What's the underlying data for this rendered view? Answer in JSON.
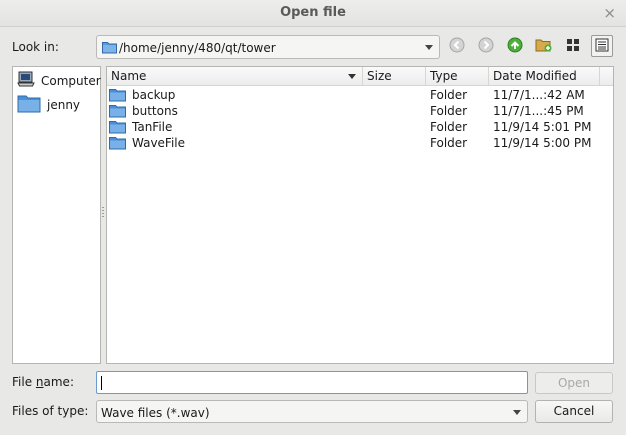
{
  "window": {
    "title": "Open file",
    "close_glyph": "×"
  },
  "look_in": {
    "label": "Look in:",
    "path": "/home/jenny/480/qt/tower"
  },
  "toolbar": {
    "buttons": [
      "back-icon",
      "forward-icon",
      "parent-directory-icon",
      "new-folder-icon",
      "list-view-icon",
      "detail-view-icon"
    ]
  },
  "sidebar": {
    "items": [
      {
        "label": "Computer",
        "icon": "computer-icon"
      },
      {
        "label": "jenny",
        "icon": "folder-icon"
      }
    ]
  },
  "file_list": {
    "columns": [
      "Name",
      "Size",
      "Type",
      "Date Modified"
    ],
    "rows": [
      {
        "name": "backup",
        "size": "",
        "type": "Folder",
        "modified": "11/7/1...:42 AM"
      },
      {
        "name": "buttons",
        "size": "",
        "type": "Folder",
        "modified": "11/7/1...:45 PM"
      },
      {
        "name": "TanFile",
        "size": "",
        "type": "Folder",
        "modified": "11/9/14 5:01 PM"
      },
      {
        "name": "WaveFile",
        "size": "",
        "type": "Folder",
        "modified": "11/9/14 5:00 PM"
      }
    ]
  },
  "file_name": {
    "label": "File name:",
    "value": ""
  },
  "file_type": {
    "label": "Files of type:",
    "value": "Wave files (*.wav)"
  },
  "buttons": {
    "open": "Open",
    "cancel": "Cancel"
  },
  "colors": {
    "folder": "#4a90d9",
    "focus": "#6a9ad0"
  }
}
